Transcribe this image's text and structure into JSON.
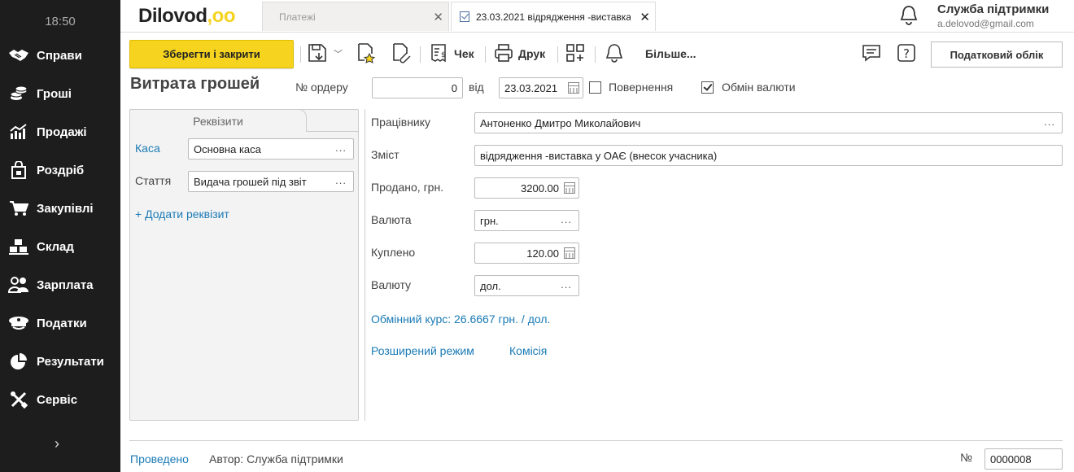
{
  "sidebar": {
    "time": "18:50",
    "items": [
      {
        "label": "Справи",
        "icon": "handshake-icon"
      },
      {
        "label": "Гроші",
        "icon": "coins-icon"
      },
      {
        "label": "Продажі",
        "icon": "sales-chart-icon"
      },
      {
        "label": "Роздріб",
        "icon": "shopping-bag-icon"
      },
      {
        "label": "Закупівлі",
        "icon": "cart-icon"
      },
      {
        "label": "Склад",
        "icon": "boxes-icon"
      },
      {
        "label": "Зарплата",
        "icon": "people-icon"
      },
      {
        "label": "Податки",
        "icon": "officer-cap-icon"
      },
      {
        "label": "Результати",
        "icon": "pie-chart-icon"
      },
      {
        "label": "Сервіс",
        "icon": "tools-icon"
      }
    ],
    "expand_icon": "chevron-right-icon"
  },
  "header": {
    "logo_text": "Dilovod",
    "logo_dots": ",oo",
    "tabs": [
      {
        "label": "Платежі"
      },
      {
        "label": "23.03.2021 відрядження -виставка"
      }
    ],
    "user_name": "Служба підтримки",
    "user_email": "a.delovod@gmail.com"
  },
  "toolbar": {
    "save_close": "Зберегти і закрити",
    "check": "Чек",
    "print": "Друк",
    "more": "Більше...",
    "tax_accounting": "Податковий облік"
  },
  "form": {
    "title": "Витрата грошей",
    "order_label": "№ ордеру",
    "order_value": "0",
    "date_from_label": "від",
    "date_value": "23.03.2021",
    "returned_label": "Повернення",
    "returned_checked": false,
    "exchange_label": "Обмін валюти",
    "exchange_checked": true
  },
  "requisites": {
    "tab_label": "Реквізити",
    "kasa_label": "Каса",
    "kasa_value": "Основна каса",
    "article_label": "Стаття",
    "article_value": "Видача грошей під звіт",
    "add_label": "+ Додати реквізит"
  },
  "details": {
    "employee_label": "Працівнику",
    "employee_value": "Антоненко Дмитро Миколайович",
    "content_label": "Зміст",
    "content_value": "відрядження -виставка у ОАЄ (внесок учасника)",
    "sold_label": "Продано, грн.",
    "sold_value": "3200.00",
    "currency_label": "Валюта",
    "currency_value": "грн.",
    "bought_label": "Куплено",
    "bought_value": "120.00",
    "currency2_label": "Валюту",
    "currency2_value": "дол.",
    "rate_text": "Обмінний курс: 26.6667 грн. / дол.",
    "extended_mode": "Розширений режим",
    "commission": "Комісія"
  },
  "footer": {
    "status": "Проведено",
    "author": "Автор: Служба підтримки",
    "number_label": "№",
    "number_value": "0000008"
  }
}
